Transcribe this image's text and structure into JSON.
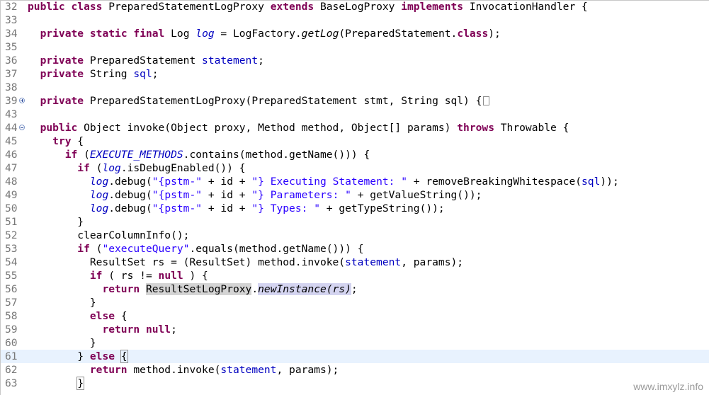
{
  "editor": {
    "lines": [
      {
        "n": "32",
        "tokens": [
          [
            "public",
            "kw"
          ],
          [
            " ",
            ""
          ],
          [
            "class",
            "kw"
          ],
          [
            " PreparedStatementLogProxy ",
            ""
          ],
          [
            "extends",
            "kw"
          ],
          [
            " BaseLogProxy ",
            ""
          ],
          [
            "implements",
            "kw"
          ],
          [
            " InvocationHandler {",
            ""
          ]
        ]
      },
      {
        "n": "33",
        "tokens": []
      },
      {
        "n": "34",
        "tokens": [
          [
            "  ",
            ""
          ],
          [
            "private",
            "kw"
          ],
          [
            " ",
            ""
          ],
          [
            "static",
            "kw"
          ],
          [
            " ",
            ""
          ],
          [
            "final",
            "kw"
          ],
          [
            " Log ",
            ""
          ],
          [
            "log",
            "sfld"
          ],
          [
            " = LogFactory.",
            ""
          ],
          [
            "getLog",
            "smeth"
          ],
          [
            "(PreparedStatement.",
            ""
          ],
          [
            "class",
            "kw"
          ],
          [
            ");",
            ""
          ]
        ]
      },
      {
        "n": "35",
        "tokens": []
      },
      {
        "n": "36",
        "tokens": [
          [
            "  ",
            ""
          ],
          [
            "private",
            "kw"
          ],
          [
            " PreparedStatement ",
            ""
          ],
          [
            "statement",
            "fld"
          ],
          [
            ";",
            ""
          ]
        ]
      },
      {
        "n": "37",
        "tokens": [
          [
            "  ",
            ""
          ],
          [
            "private",
            "kw"
          ],
          [
            " String ",
            ""
          ],
          [
            "sql",
            "fld"
          ],
          [
            ";",
            ""
          ]
        ]
      },
      {
        "n": "38",
        "tokens": []
      },
      {
        "n": "39",
        "fold": "plus",
        "tokens": [
          [
            "  ",
            ""
          ],
          [
            "private",
            "kw"
          ],
          [
            " PreparedStatementLogProxy(PreparedStatement stmt, String sql) {",
            ""
          ]
        ],
        "collapsed": true
      },
      {
        "n": "43",
        "tokens": []
      },
      {
        "n": "44",
        "fold": "minus",
        "tokens": [
          [
            "  ",
            ""
          ],
          [
            "public",
            "kw"
          ],
          [
            " Object invoke(Object proxy, Method method, Object[] params) ",
            ""
          ],
          [
            "throws",
            "kw"
          ],
          [
            " Throwable {",
            ""
          ]
        ]
      },
      {
        "n": "45",
        "tokens": [
          [
            "    ",
            ""
          ],
          [
            "try",
            "kw"
          ],
          [
            " {",
            ""
          ]
        ]
      },
      {
        "n": "46",
        "tokens": [
          [
            "      ",
            ""
          ],
          [
            "if",
            "kw"
          ],
          [
            " (",
            ""
          ],
          [
            "EXECUTE_METHODS",
            "sfld"
          ],
          [
            ".contains(method.getName())) {",
            ""
          ]
        ]
      },
      {
        "n": "47",
        "tokens": [
          [
            "        ",
            ""
          ],
          [
            "if",
            "kw"
          ],
          [
            " (",
            ""
          ],
          [
            "log",
            "sfld"
          ],
          [
            ".isDebugEnabled()) {",
            ""
          ]
        ]
      },
      {
        "n": "48",
        "tokens": [
          [
            "          ",
            ""
          ],
          [
            "log",
            "sfld"
          ],
          [
            ".debug(",
            ""
          ],
          [
            "\"{pstm-\"",
            "str"
          ],
          [
            " + id + ",
            ""
          ],
          [
            "\"} Executing Statement: \"",
            "str"
          ],
          [
            " + removeBreakingWhitespace(",
            ""
          ],
          [
            "sql",
            "fld"
          ],
          [
            "));",
            ""
          ]
        ]
      },
      {
        "n": "49",
        "tokens": [
          [
            "          ",
            ""
          ],
          [
            "log",
            "sfld"
          ],
          [
            ".debug(",
            ""
          ],
          [
            "\"{pstm-\"",
            "str"
          ],
          [
            " + id + ",
            ""
          ],
          [
            "\"} Parameters: \"",
            "str"
          ],
          [
            " + getValueString());",
            ""
          ]
        ]
      },
      {
        "n": "50",
        "tokens": [
          [
            "          ",
            ""
          ],
          [
            "log",
            "sfld"
          ],
          [
            ".debug(",
            ""
          ],
          [
            "\"{pstm-\"",
            "str"
          ],
          [
            " + id + ",
            ""
          ],
          [
            "\"} Types: \"",
            "str"
          ],
          [
            " + getTypeString());",
            ""
          ]
        ]
      },
      {
        "n": "51",
        "tokens": [
          [
            "        }",
            ""
          ]
        ]
      },
      {
        "n": "52",
        "tokens": [
          [
            "        clearColumnInfo();",
            ""
          ]
        ]
      },
      {
        "n": "53",
        "tokens": [
          [
            "        ",
            ""
          ],
          [
            "if",
            "kw"
          ],
          [
            " (",
            ""
          ],
          [
            "\"executeQuery\"",
            "str"
          ],
          [
            ".equals(method.getName())) {",
            ""
          ]
        ]
      },
      {
        "n": "54",
        "tokens": [
          [
            "          ResultSet rs = (ResultSet) method.invoke(",
            ""
          ],
          [
            "statement",
            "fld"
          ],
          [
            ", params);",
            ""
          ]
        ]
      },
      {
        "n": "55",
        "tokens": [
          [
            "          ",
            ""
          ],
          [
            "if",
            "kw"
          ],
          [
            " ( rs != ",
            ""
          ],
          [
            "null",
            "kw"
          ],
          [
            " ) {",
            ""
          ]
        ]
      },
      {
        "n": "56",
        "tokens": [
          [
            "            ",
            ""
          ],
          [
            "return",
            "kw"
          ],
          [
            " ",
            ""
          ],
          [
            "ResultSetLogProxy",
            "occ1"
          ],
          [
            ".",
            ""
          ],
          [
            "newInstance(rs)",
            "occ2 smeth"
          ],
          [
            ";",
            ""
          ]
        ]
      },
      {
        "n": "57",
        "tokens": [
          [
            "          }",
            ""
          ]
        ]
      },
      {
        "n": "58",
        "tokens": [
          [
            "          ",
            ""
          ],
          [
            "else",
            "kw"
          ],
          [
            " {",
            ""
          ]
        ]
      },
      {
        "n": "59",
        "tokens": [
          [
            "            ",
            ""
          ],
          [
            "return",
            "kw"
          ],
          [
            " ",
            ""
          ],
          [
            "null",
            "kw"
          ],
          [
            ";",
            ""
          ]
        ]
      },
      {
        "n": "60",
        "tokens": [
          [
            "          }",
            ""
          ]
        ]
      },
      {
        "n": "61",
        "current": true,
        "tokens": [
          [
            "        } ",
            ""
          ],
          [
            "else",
            "kw"
          ],
          [
            " ",
            ""
          ],
          [
            "{",
            "brk"
          ]
        ],
        "caret": true
      },
      {
        "n": "62",
        "tokens": [
          [
            "          ",
            ""
          ],
          [
            "return",
            "kw"
          ],
          [
            " method.invoke(",
            ""
          ],
          [
            "statement",
            "fld"
          ],
          [
            ", params);",
            ""
          ]
        ]
      },
      {
        "n": "63",
        "tokens": [
          [
            "        ",
            ""
          ],
          [
            "}",
            "brk"
          ]
        ]
      }
    ]
  },
  "watermark": "www.imxylz.info"
}
